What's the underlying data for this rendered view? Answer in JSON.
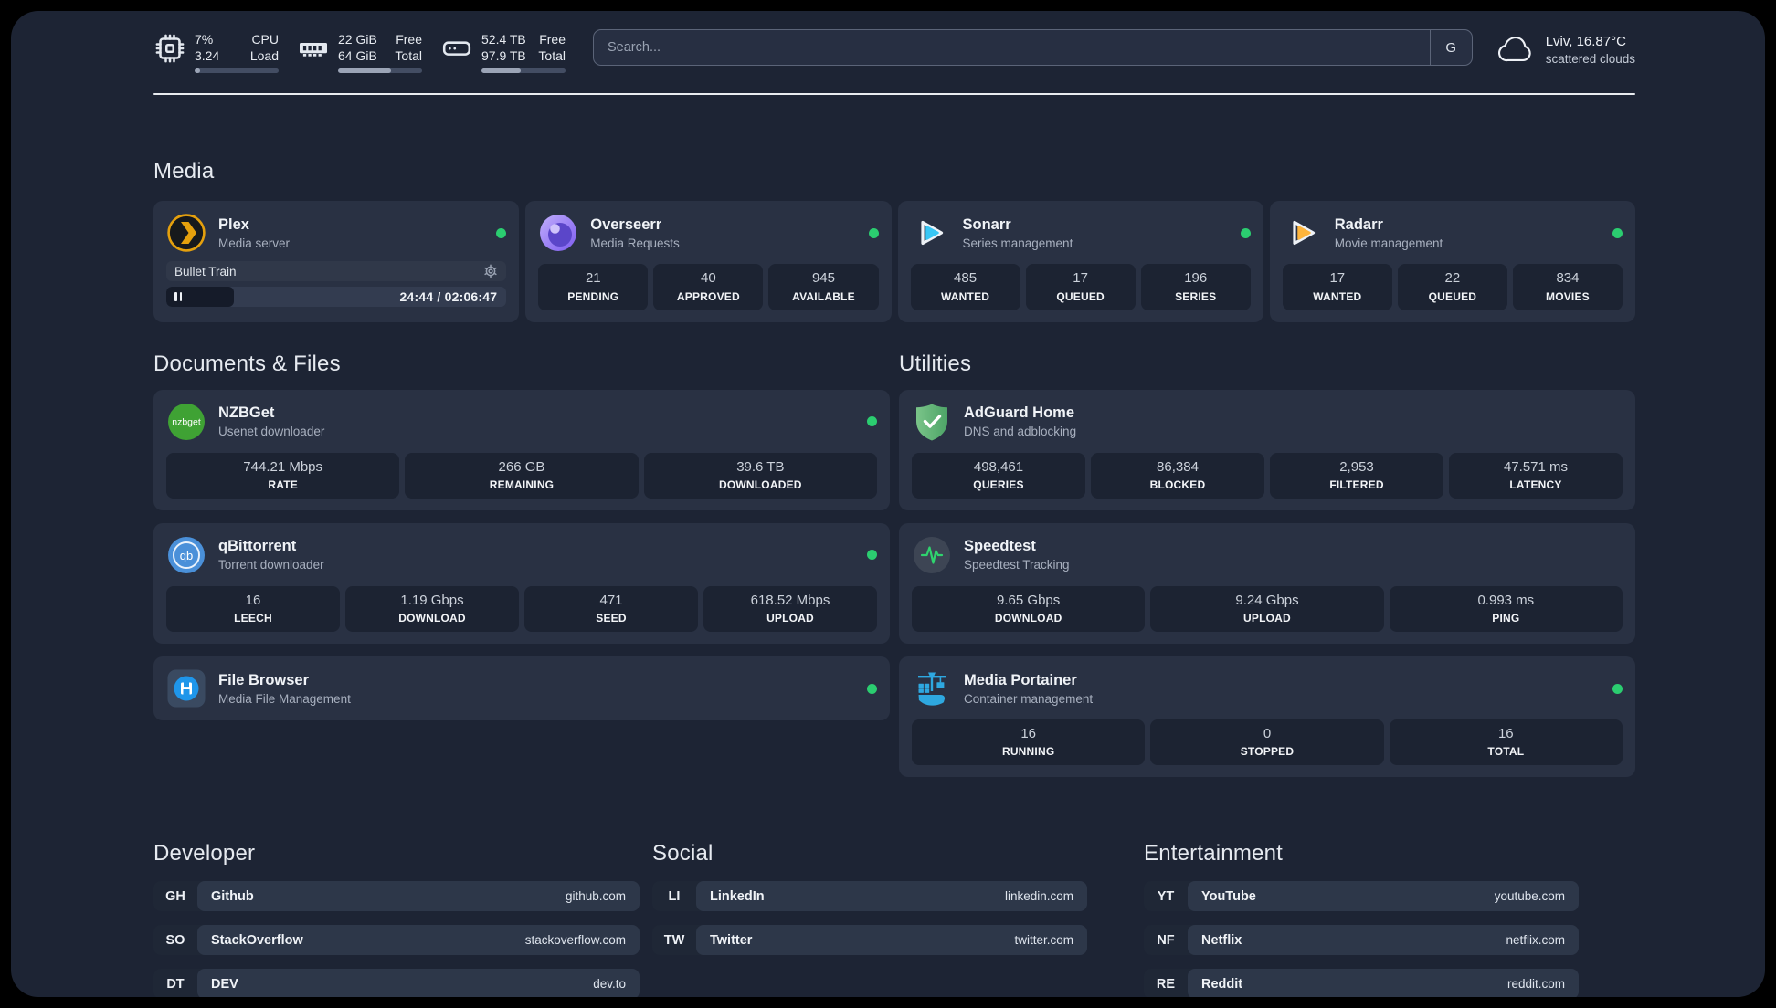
{
  "header": {
    "metrics": [
      {
        "icon": "cpu-icon",
        "value1": "7%",
        "label1": "CPU",
        "value2": "3.24",
        "label2": "Load",
        "progress_pct": 7
      },
      {
        "icon": "ram-icon",
        "value1": "22 GiB",
        "label1": "Free",
        "value2": "64 GiB",
        "label2": "Total",
        "progress_pct": 63
      },
      {
        "icon": "disk-icon",
        "value1": "52.4 TB",
        "label1": "Free",
        "value2": "97.9 TB",
        "label2": "Total",
        "progress_pct": 47
      }
    ],
    "search": {
      "placeholder": "Search...",
      "engine_button": "G"
    },
    "weather": {
      "location_temp": "Lviv, 16.87°C",
      "condition": "scattered clouds"
    }
  },
  "sections": {
    "media": {
      "title": "Media",
      "plex": {
        "name": "Plex",
        "subtitle": "Media server",
        "status": "online",
        "now_playing": {
          "title": "Bullet Train",
          "time": "24:44 / 02:06:47",
          "state": "paused",
          "progress_pct": 20
        }
      },
      "overseerr": {
        "name": "Overseerr",
        "subtitle": "Media Requests",
        "status": "online",
        "stats": [
          {
            "value": "21",
            "label": "PENDING"
          },
          {
            "value": "40",
            "label": "APPROVED"
          },
          {
            "value": "945",
            "label": "AVAILABLE"
          }
        ]
      },
      "sonarr": {
        "name": "Sonarr",
        "subtitle": "Series management",
        "status": "online",
        "stats": [
          {
            "value": "485",
            "label": "WANTED"
          },
          {
            "value": "17",
            "label": "QUEUED"
          },
          {
            "value": "196",
            "label": "SERIES"
          }
        ]
      },
      "radarr": {
        "name": "Radarr",
        "subtitle": "Movie management",
        "status": "online",
        "stats": [
          {
            "value": "17",
            "label": "WANTED"
          },
          {
            "value": "22",
            "label": "QUEUED"
          },
          {
            "value": "834",
            "label": "MOVIES"
          }
        ]
      }
    },
    "documents": {
      "title": "Documents & Files",
      "nzbget": {
        "name": "NZBGet",
        "subtitle": "Usenet downloader",
        "status": "online",
        "stats": [
          {
            "value": "744.21 Mbps",
            "label": "RATE"
          },
          {
            "value": "266 GB",
            "label": "REMAINING"
          },
          {
            "value": "39.6 TB",
            "label": "DOWNLOADED"
          }
        ]
      },
      "qbittorrent": {
        "name": "qBittorrent",
        "subtitle": "Torrent downloader",
        "status": "online",
        "stats": [
          {
            "value": "16",
            "label": "LEECH"
          },
          {
            "value": "1.19 Gbps",
            "label": "DOWNLOAD"
          },
          {
            "value": "471",
            "label": "SEED"
          },
          {
            "value": "618.52 Mbps",
            "label": "UPLOAD"
          }
        ]
      },
      "filebrowser": {
        "name": "File Browser",
        "subtitle": "Media File Management",
        "status": "online"
      }
    },
    "utilities": {
      "title": "Utilities",
      "adguard": {
        "name": "AdGuard Home",
        "subtitle": "DNS and adblocking",
        "stats": [
          {
            "value": "498,461",
            "label": "QUERIES"
          },
          {
            "value": "86,384",
            "label": "BLOCKED"
          },
          {
            "value": "2,953",
            "label": "FILTERED"
          },
          {
            "value": "47.571 ms",
            "label": "LATENCY"
          }
        ]
      },
      "speedtest": {
        "name": "Speedtest",
        "subtitle": "Speedtest Tracking",
        "stats": [
          {
            "value": "9.65 Gbps",
            "label": "DOWNLOAD"
          },
          {
            "value": "9.24 Gbps",
            "label": "UPLOAD"
          },
          {
            "value": "0.993 ms",
            "label": "PING"
          }
        ]
      },
      "portainer": {
        "name": "Media Portainer",
        "subtitle": "Container management",
        "status": "online",
        "stats": [
          {
            "value": "16",
            "label": "RUNNING"
          },
          {
            "value": "0",
            "label": "STOPPED"
          },
          {
            "value": "16",
            "label": "TOTAL"
          }
        ]
      }
    },
    "developer": {
      "title": "Developer",
      "links": [
        {
          "abbr": "GH",
          "name": "Github",
          "url": "github.com"
        },
        {
          "abbr": "SO",
          "name": "StackOverflow",
          "url": "stackoverflow.com"
        },
        {
          "abbr": "DT",
          "name": "DEV",
          "url": "dev.to"
        }
      ]
    },
    "social": {
      "title": "Social",
      "links": [
        {
          "abbr": "LI",
          "name": "LinkedIn",
          "url": "linkedin.com"
        },
        {
          "abbr": "TW",
          "name": "Twitter",
          "url": "twitter.com"
        }
      ]
    },
    "entertainment": {
      "title": "Entertainment",
      "links": [
        {
          "abbr": "YT",
          "name": "YouTube",
          "url": "youtube.com"
        },
        {
          "abbr": "NF",
          "name": "Netflix",
          "url": "netflix.com"
        },
        {
          "abbr": "RE",
          "name": "Reddit",
          "url": "reddit.com"
        }
      ]
    }
  },
  "colors": {
    "status_online": "#2bcd70",
    "plex": "#e5a00d",
    "overseerr": "#8b6cf0",
    "sonarr": "#38c6f4",
    "radarr": "#ffb53c",
    "nzbget": "#3fa234",
    "qbittorrent": "#4a90d9",
    "filebrowser": "#1f96ea",
    "adguard": "#67b279",
    "speedtest_pulse": "#2fd36e",
    "portainer": "#2ea8e0",
    "panel_bg": "#1d2434",
    "card_bg": "#293143",
    "stat_bg": "#1c2332"
  }
}
